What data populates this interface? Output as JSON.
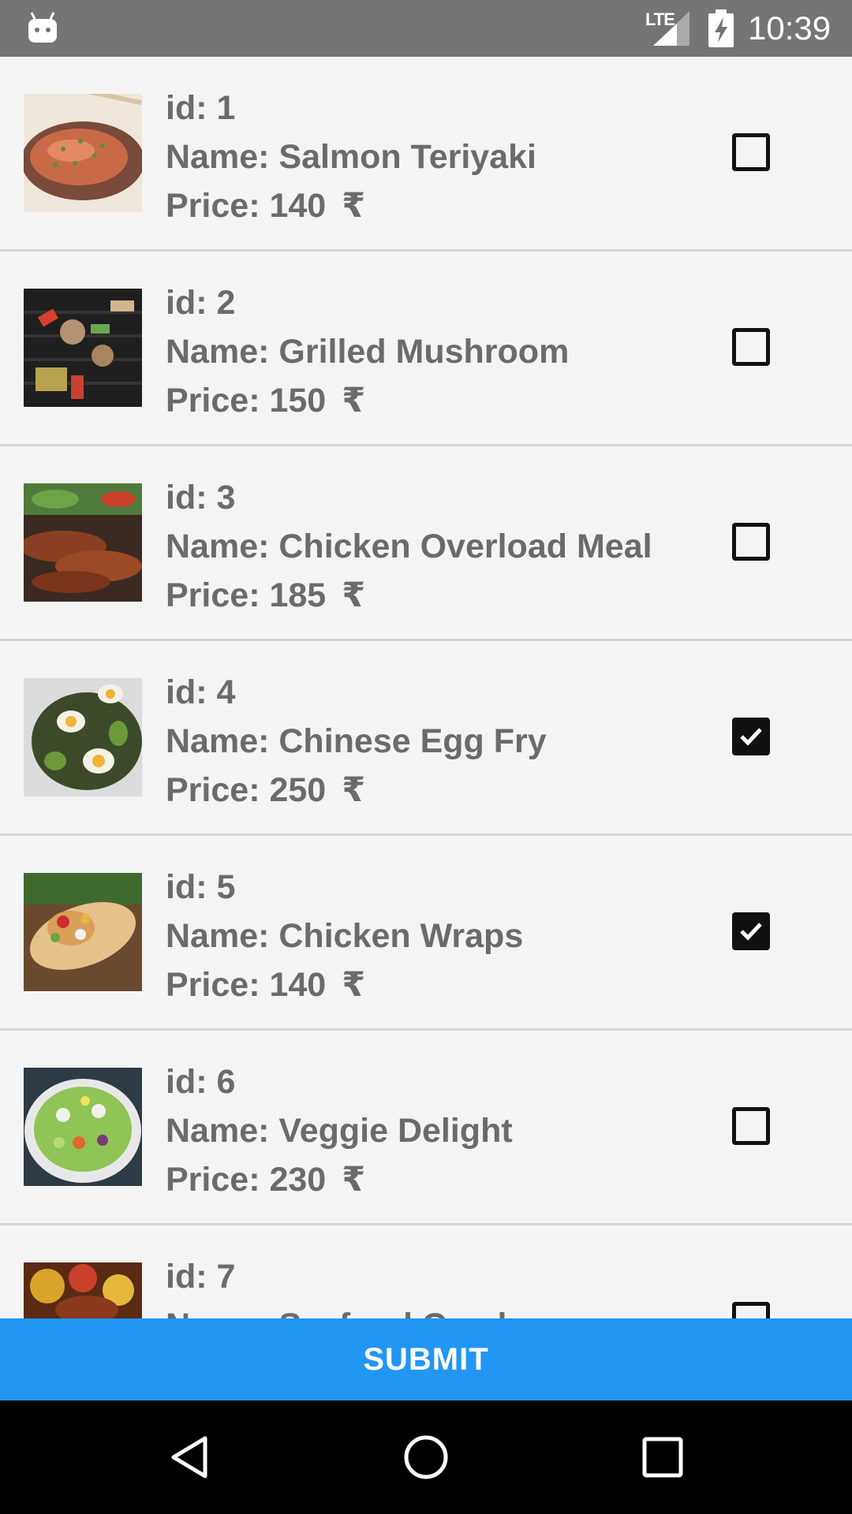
{
  "status_bar": {
    "network": "LTE",
    "time": "10:39",
    "icons": [
      "android-icon",
      "lte-signal-icon",
      "battery-charging-icon"
    ]
  },
  "currency_symbol": "₹",
  "items": [
    {
      "id_text": "id: 1",
      "name_text": "Name: Salmon Teriyaki",
      "price_text": "Price: 140",
      "checked": false,
      "thumb": "salmon-image"
    },
    {
      "id_text": "id: 2",
      "name_text": "Name: Grilled Mushroom",
      "price_text": "Price: 150",
      "checked": false,
      "thumb": "mushroom-image"
    },
    {
      "id_text": "id: 3",
      "name_text": "Name: Chicken Overload Meal",
      "price_text": "Price: 185",
      "checked": false,
      "thumb": "chicken-image"
    },
    {
      "id_text": "id: 4",
      "name_text": "Name: Chinese Egg Fry",
      "price_text": "Price: 250",
      "checked": true,
      "thumb": "egg-image"
    },
    {
      "id_text": "id: 5",
      "name_text": "Name: Chicken Wraps",
      "price_text": "Price: 140",
      "checked": true,
      "thumb": "wrap-image"
    },
    {
      "id_text": "id: 6",
      "name_text": "Name: Veggie Delight",
      "price_text": "Price: 230",
      "checked": false,
      "thumb": "salad-image"
    },
    {
      "id_text": "id: 7",
      "name_text": "Name: Seafood Combo",
      "price_text": "",
      "checked": false,
      "thumb": "seafood-image"
    }
  ],
  "submit_label": "SUBMIT",
  "nav": [
    "back-icon",
    "home-icon",
    "recents-icon"
  ],
  "colors": {
    "accent": "#2196f3",
    "status_bar": "#757575",
    "text": "#6b6b6b",
    "background": "#f4f4f4"
  }
}
